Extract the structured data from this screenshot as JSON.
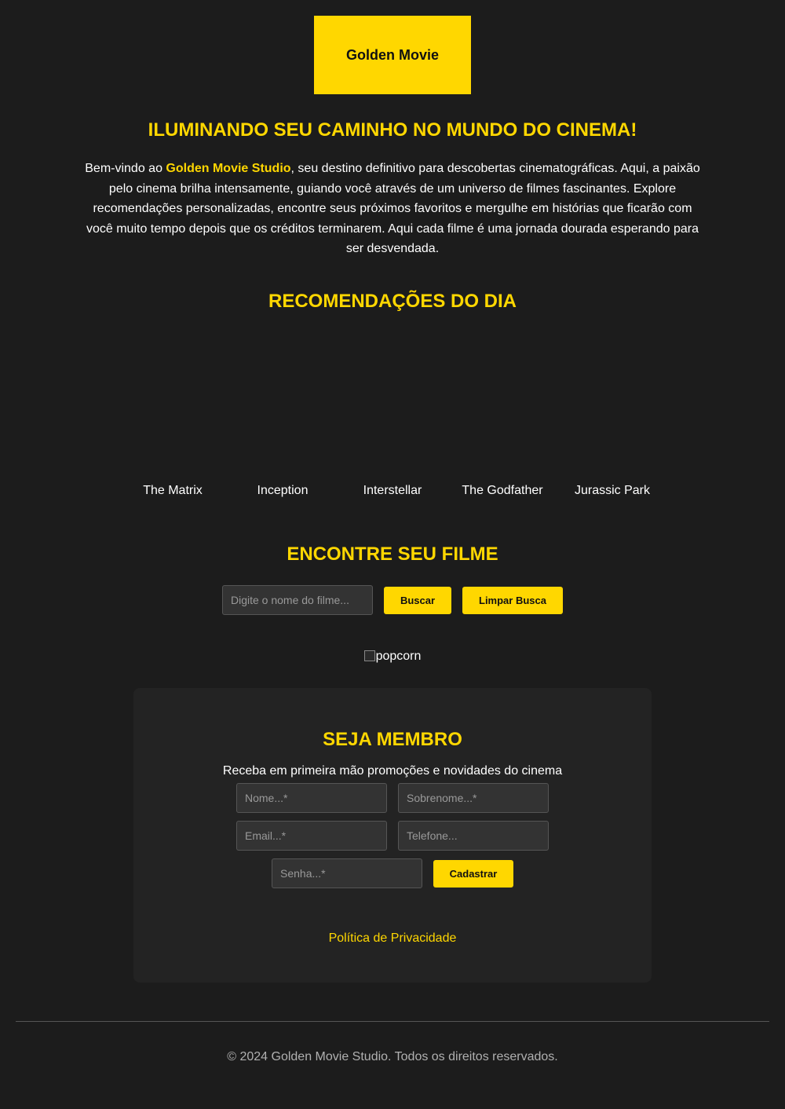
{
  "header": {
    "logo_text": "Golden Movie"
  },
  "hero": {
    "title": "ILUMINANDO SEU CAMINHO NO MUNDO DO CINEMA!",
    "intro_prefix": "Bem-vindo ao ",
    "intro_brand": "Golden Movie Studio",
    "intro_suffix": ", seu destino definitivo para descobertas cinematográficas. Aqui, a paixão pelo cinema brilha intensamente, guiando você através de um universo de filmes fascinantes. Explore recomendações personalizadas, encontre seus próximos favoritos e mergulhe em histórias que ficarão com você muito tempo depois que os créditos terminarem. Aqui cada filme é uma jornada dourada esperando para ser desvendada."
  },
  "recommendations": {
    "title": "RECOMENDAÇÕES DO DIA",
    "movies": [
      "The Matrix",
      "Inception",
      "Interstellar",
      "The Godfather",
      "Jurassic Park"
    ]
  },
  "search": {
    "title": "ENCONTRE SEU FILME",
    "placeholder": "Digite o nome do filme...",
    "search_button": "Buscar",
    "clear_button": "Limpar Busca"
  },
  "popcorn": {
    "alt_text": "popcorn"
  },
  "membership": {
    "title": "SEJA MEMBRO",
    "subtitle": "Receba em primeira mão promoções e novidades do cinema",
    "first_name_placeholder": "Nome...*",
    "last_name_placeholder": "Sobrenome...*",
    "email_placeholder": "Email...*",
    "phone_placeholder": "Telefone...",
    "password_placeholder": "Senha...*",
    "submit_button": "Cadastrar",
    "privacy_link": "Política de Privacidade"
  },
  "footer": {
    "copyright": "© 2024 Golden Movie Studio. Todos os direitos reservados."
  },
  "colors": {
    "accent": "#ffd700",
    "background": "#1c1c1c",
    "card": "#232323"
  }
}
